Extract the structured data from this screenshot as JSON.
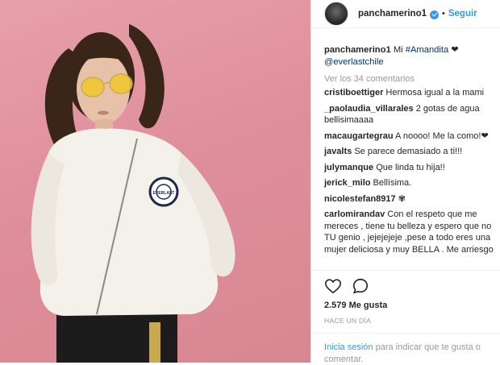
{
  "post": {
    "username": "panchamerino1",
    "follow_label": "Seguir",
    "dot": "•"
  },
  "caption": {
    "username": "panchamerino1",
    "text": "Mi",
    "hashtag": "#Amandita",
    "heart": "❤",
    "mention": "@everlastchile"
  },
  "view_all_label": "Ver los 34 comentarios",
  "comments": [
    {
      "user": "cristiboettiger",
      "text": "Hermosa igual a la mami"
    },
    {
      "user": "_paolaudia_villarales",
      "text": "2 gotas de agua bellisimaaaa"
    },
    {
      "user": "macaugartegrau",
      "text": "A noooo! Me la como!❤"
    },
    {
      "user": "javalts",
      "text": "Se parece demasiado a ti!!!"
    },
    {
      "user": "julymanque",
      "text": "Que linda tu hija!!"
    },
    {
      "user": "jerick_milo",
      "text": "Bellísima."
    },
    {
      "user": "nicolestefan8917",
      "text": "✾"
    },
    {
      "user": "carlomirandav",
      "text": "Con el respeto que me mereces , tiene tu belleza y espero que no TU genio , jejejejeje ,pese a todo eres una mujer deliciosa y muy BELLA . Me arriesgo a demanda pero No estoy ni ahi con ESO"
    }
  ],
  "likes": "2.579 Me gusta",
  "date": "HACE UN DÍA",
  "footer": {
    "login_label": "Inicia sesión",
    "rest": "para indicar que te gusta o comentar."
  },
  "icons": {
    "like": "heart-outline-icon",
    "comment": "comment-bubble-icon",
    "verified": "verified-badge-icon"
  },
  "colors": {
    "accent": "#3897f0",
    "hashtag": "#003569",
    "muted": "#999999",
    "photo_background": "#e29aa5"
  },
  "photo": {
    "badge_text": "EVERLAST"
  }
}
